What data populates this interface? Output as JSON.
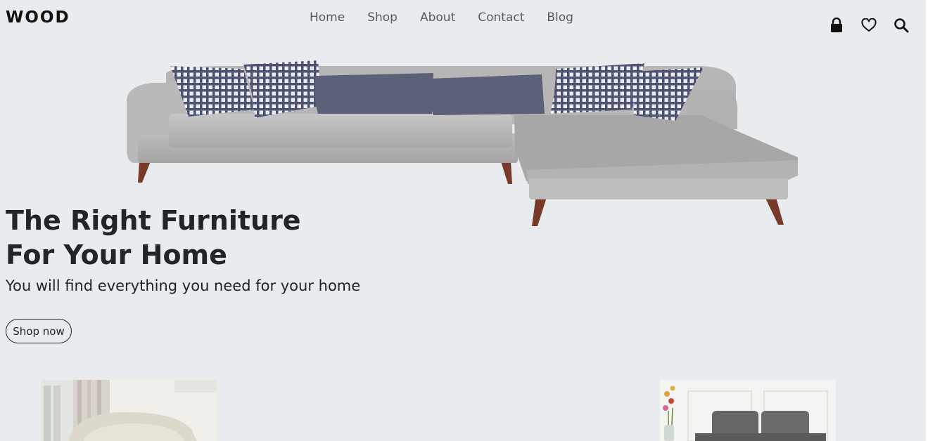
{
  "header": {
    "logo": "WOOD",
    "nav": [
      "Home",
      "Shop",
      "About",
      "Contact",
      "Blog"
    ],
    "icons": [
      "lock-icon",
      "heart-icon",
      "search-icon"
    ]
  },
  "hero": {
    "title_line1": "The Right Furniture",
    "title_line2": "For Your Home",
    "subtitle": "You will find everything you need for your home",
    "cta_label": "Shop now",
    "image": "grey-sectional-sofa"
  },
  "products": [
    {
      "image": "cream-armchair"
    },
    {
      "image": "grey-sofa-with-flowers"
    }
  ],
  "colors": {
    "background": "#e9ecef",
    "text": "#212529",
    "nav_text": "#555b61"
  }
}
